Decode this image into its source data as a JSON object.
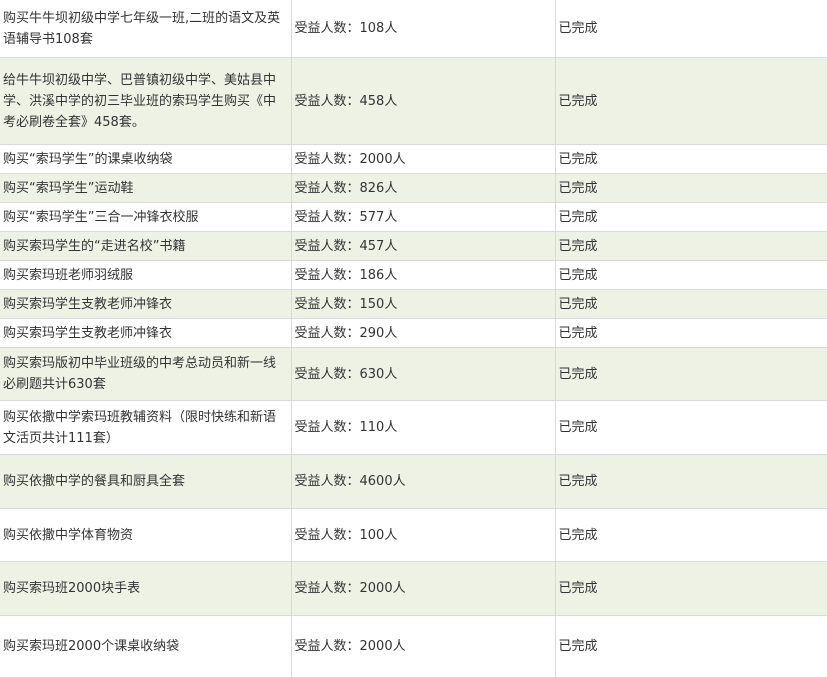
{
  "rows": [
    {
      "project": "购买牛牛坝初级中学七年级一班,二班的语文及英语辅导书108套",
      "beneficiaries": "受益人数：108人",
      "status": "已完成"
    },
    {
      "project": "给牛牛坝初级中学、巴普镇初级中学、美姑县中学、洪溪中学的初三毕业班的索玛学生购买《中考必刷卷全套》458套。",
      "beneficiaries": "受益人数：458人",
      "status": "已完成"
    },
    {
      "project": "购买“索玛学生”的课桌收纳袋",
      "beneficiaries": "受益人数：2000人",
      "status": "已完成"
    },
    {
      "project": "购买“索玛学生”运动鞋",
      "beneficiaries": "受益人数：826人",
      "status": "已完成"
    },
    {
      "project": "购买“索玛学生”三合一冲锋衣校服",
      "beneficiaries": "受益人数：577人",
      "status": "已完成"
    },
    {
      "project": "购买索玛学生的“走进名校”书籍",
      "beneficiaries": "受益人数：457人",
      "status": "已完成"
    },
    {
      "project": "购买索玛班老师羽绒服",
      "beneficiaries": "受益人数：186人",
      "status": "已完成"
    },
    {
      "project": "购买索玛学生支教老师冲锋衣",
      "beneficiaries": "受益人数：150人",
      "status": "已完成"
    },
    {
      "project": "购买索玛学生支教老师冲锋衣",
      "beneficiaries": "受益人数：290人",
      "status": "已完成"
    },
    {
      "project": "购买索玛版初中毕业班级的中考总动员和新一线必刷题共计630套",
      "beneficiaries": "受益人数：630人",
      "status": "已完成"
    },
    {
      "project": "购买依撒中学索玛班教辅资料（限时快练和新语文活页共计111套）",
      "beneficiaries": "受益人数：110人",
      "status": "已完成"
    },
    {
      "project": "购买依撒中学的餐具和厨具全套",
      "beneficiaries": "受益人数：4600人",
      "status": "已完成"
    },
    {
      "project": "购买依撒中学体育物资",
      "beneficiaries": "受益人数：100人",
      "status": "已完成"
    },
    {
      "project": "购买索玛班2000块手表",
      "beneficiaries": "受益人数：2000人",
      "status": "已完成"
    },
    {
      "project": "购买索玛班2000个课桌收纳袋",
      "beneficiaries": "受益人数：2000人",
      "status": "已完成"
    }
  ]
}
